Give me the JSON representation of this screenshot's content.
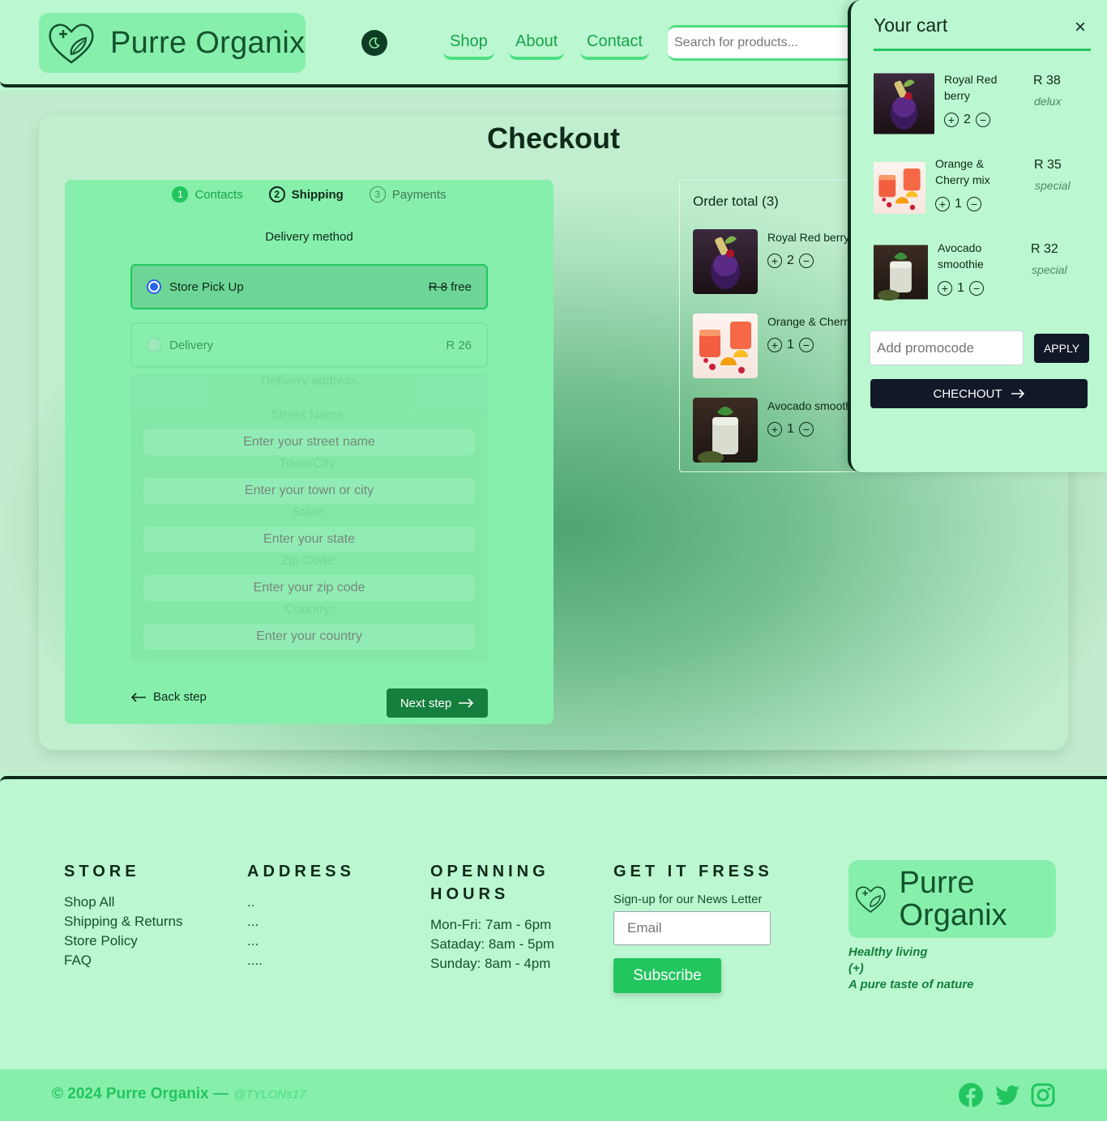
{
  "header": {
    "brand": "Purre Organix",
    "nav": [
      "Shop",
      "About",
      "Contact"
    ],
    "search_placeholder": "Search for products..."
  },
  "checkout": {
    "title": "Checkout",
    "steps": [
      {
        "num": "1",
        "label": "Contacts",
        "state": "done"
      },
      {
        "num": "2",
        "label": "Shipping",
        "state": "active"
      },
      {
        "num": "3",
        "label": "Payments",
        "state": "todo"
      }
    ],
    "delivery_heading": "Delivery method",
    "options": [
      {
        "label": "Store Pick Up",
        "old_price": "R 8",
        "price": "free",
        "selected": true
      },
      {
        "label": "Delivery",
        "price": "R 26",
        "selected": false
      }
    ],
    "address": {
      "title": "Delivery address",
      "fields": [
        {
          "label": "Street Name:",
          "placeholder": "Enter your street name"
        },
        {
          "label": "Town/City:",
          "placeholder": "Enter your town or city"
        },
        {
          "label": "State:",
          "placeholder": "Enter your state"
        },
        {
          "label": "Zip Code:",
          "placeholder": "Enter your zip code"
        },
        {
          "label": "Country:",
          "placeholder": "Enter your country"
        }
      ]
    },
    "back_label": "Back step",
    "next_label": "Next step"
  },
  "order": {
    "title": "Order total (3)",
    "items": [
      {
        "name": "Royal Red berry",
        "qty": "2"
      },
      {
        "name": "Orange & Cherry mix",
        "qty": "1"
      },
      {
        "name": "Avocado smoothie",
        "qty": "1"
      }
    ]
  },
  "cart": {
    "title": "Your cart",
    "close": "×",
    "items": [
      {
        "name": "Royal Red berry",
        "qty": "2",
        "price": "R 38",
        "tag": "delux"
      },
      {
        "name": "Orange & Cherry mix",
        "qty": "1",
        "price": "R 35",
        "tag": "special"
      },
      {
        "name": "Avocado smoothie",
        "qty": "1",
        "price": "R 32",
        "tag": "special"
      }
    ],
    "promo_placeholder": "Add promocode",
    "apply_label": "APPLY",
    "checkout_label": "CHECHOUT"
  },
  "footer": {
    "store": {
      "heading": "STORE",
      "links": [
        "Shop All",
        "Shipping & Returns",
        "Store Policy",
        "FAQ"
      ]
    },
    "address": {
      "heading": "ADDRESS",
      "lines": [
        "..",
        "...",
        "...",
        "...."
      ]
    },
    "hours": {
      "heading": "OPENNING HOURS",
      "lines": [
        "Mon-Fri: 7am - 6pm",
        "Sataday: 8am - 5pm",
        "Sunday: 8am - 4pm"
      ]
    },
    "newsletter": {
      "heading": "GET IT FRESS",
      "text": "Sign-up for our News Letter",
      "email_placeholder": "Email",
      "button": "Subscribe"
    },
    "brand": "Purre Organix",
    "tagline": [
      "Healthy living",
      "(+)",
      "A pure taste of nature"
    ],
    "copyright": "© 2024 Purre Organix —",
    "handle": "@TYLONs17"
  },
  "colors": {
    "background": "#bbf7d0",
    "panel": "#86efac",
    "accent": "#22c55e",
    "dark": "#0f2a1a",
    "button_dark": "#111827"
  },
  "icons": [
    "heart-leaf-logo-icon",
    "moon-icon",
    "plus-circle-icon",
    "minus-circle-icon",
    "arrow-left-icon",
    "arrow-right-icon",
    "close-icon",
    "facebook-icon",
    "twitter-icon",
    "instagram-icon"
  ]
}
